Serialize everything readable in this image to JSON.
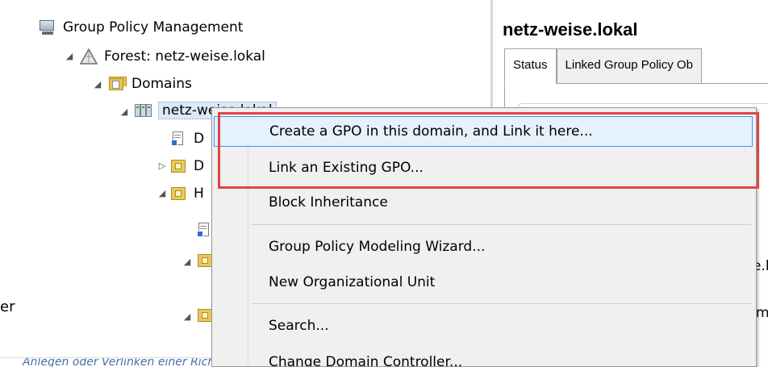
{
  "tree": {
    "root_label": "Group Policy Management",
    "forest_label": "Forest: netz-weise.lokal",
    "domains_label": "Domains",
    "domain_label": "netz-weise.lokal",
    "child_fragments": [
      "D",
      "D",
      "H"
    ],
    "left_fragment": "er"
  },
  "details": {
    "title": "netz-weise.lokal",
    "tabs": [
      "Status",
      "Linked Group Policy Ob"
    ],
    "peek_fragments": [
      "e.l",
      "m"
    ]
  },
  "context_menu": {
    "items": [
      "Create a GPO in this domain, and Link it here...",
      "Link an Existing GPO...",
      "Block Inheritance",
      "Group Policy Modeling Wizard...",
      "New Organizational Unit",
      "Search...",
      "Change Domain Controller..."
    ]
  },
  "caption": "Anlegen oder Verlinken einer Richtlinie",
  "colors": {
    "highlight": "#e04545",
    "hover_border": "#3399ff",
    "hover_fill": "#e5f1fb",
    "caption": "#4a6fa5"
  },
  "icons": [
    "console-icon",
    "forest-icon",
    "domains-icon",
    "domain-icon",
    "gpo-link-icon",
    "ou-icon"
  ]
}
